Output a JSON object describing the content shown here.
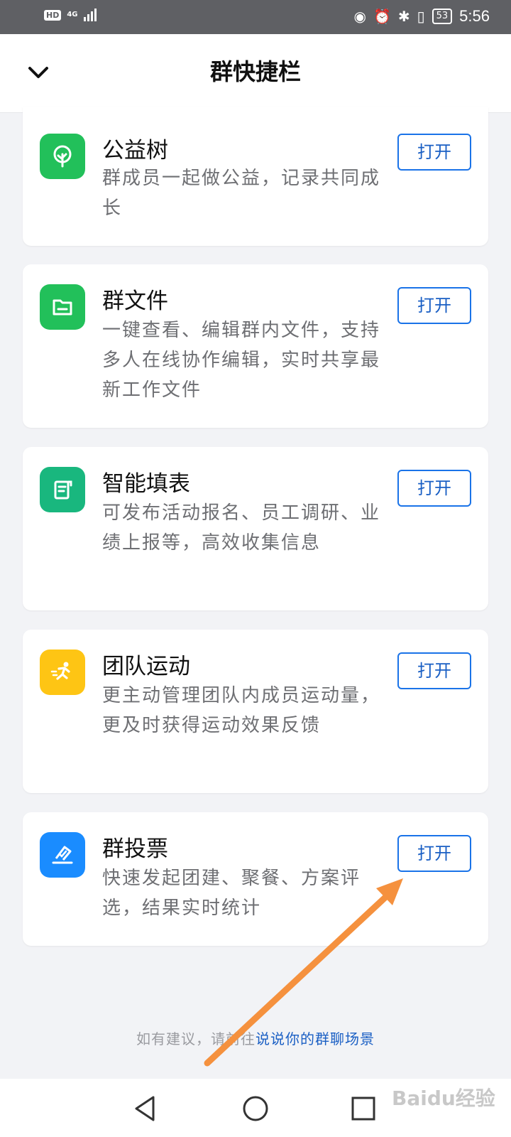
{
  "status_bar": {
    "hd": "HD",
    "network": "4G",
    "battery": "53",
    "time": "5:56"
  },
  "header": {
    "title": "群快捷栏",
    "back_icon": "chevron-down-icon"
  },
  "cards": [
    {
      "title": "公益树",
      "desc": "群成员一起做公益，记录共同成长",
      "button": "打开",
      "icon": "tree-icon",
      "icon_color": "#22c05a"
    },
    {
      "title": "群文件",
      "desc": "一键查看、编辑群内文件，支持多人在线协作编辑，实时共享最新工作文件",
      "button": "打开",
      "icon": "folder-icon",
      "icon_color": "#22c05a"
    },
    {
      "title": "智能填表",
      "desc": "可发布活动报名、员工调研、业绩上报等，高效收集信息",
      "button": "打开",
      "icon": "form-icon",
      "icon_color": "#19b77e"
    },
    {
      "title": "团队运动",
      "desc": "更主动管理团队内成员运动量，更及时获得运动效果反馈",
      "button": "打开",
      "icon": "runner-icon",
      "icon_color": "#fec514"
    },
    {
      "title": "群投票",
      "desc": "快速发起团建、聚餐、方案评选，结果实时统计",
      "button": "打开",
      "icon": "vote-icon",
      "icon_color": "#1a8cff"
    }
  ],
  "footer": {
    "prefix": "如有建议，请前往",
    "link": "说说你的群聊场景"
  },
  "watermark": "Baidu经验",
  "colors": {
    "accent_blue": "#1a5fc4",
    "annotation_arrow": "#f5913e"
  }
}
